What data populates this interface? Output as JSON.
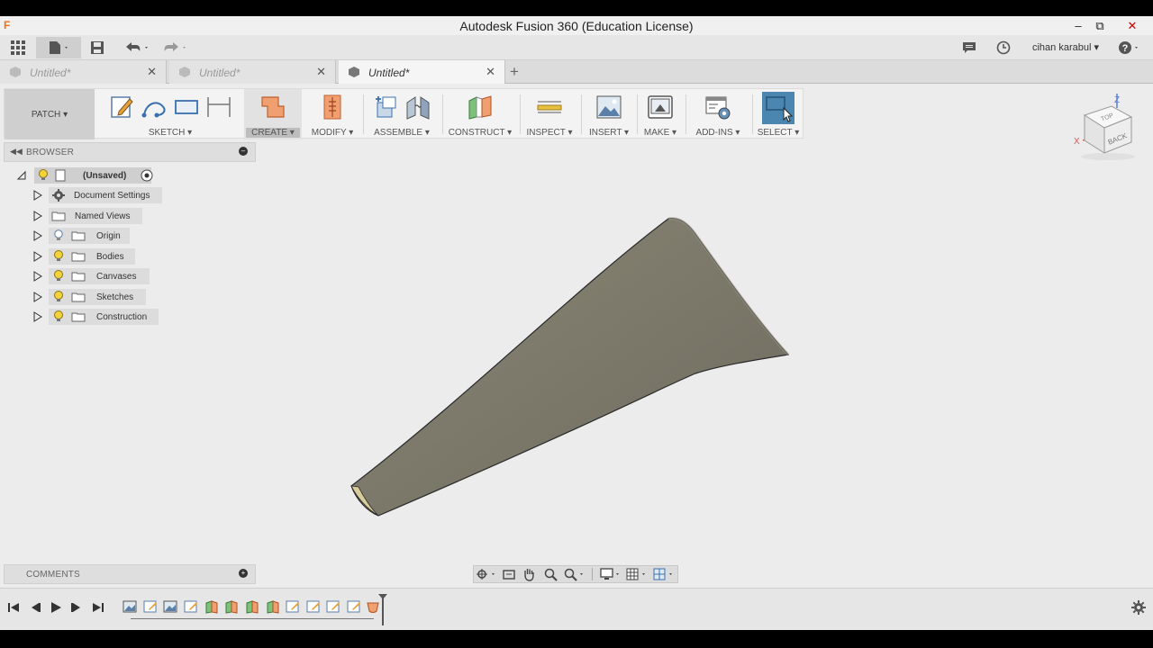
{
  "window": {
    "title": "Autodesk Fusion 360 (Education License)"
  },
  "qat": {
    "user": "cihan karabul"
  },
  "tabs": [
    {
      "label": "Untitled*",
      "active": false
    },
    {
      "label": "Untitled*",
      "active": false
    },
    {
      "label": "Untitled*",
      "active": true
    }
  ],
  "toolbar": {
    "workspace": "PATCH",
    "groups": {
      "sketch": "SKETCH",
      "create": "CREATE",
      "modify": "MODIFY",
      "assemble": "ASSEMBLE",
      "construct": "CONSTRUCT",
      "inspect": "INSPECT",
      "insert": "INSERT",
      "make": "MAKE",
      "addins": "ADD-INS",
      "select": "SELECT"
    }
  },
  "browser": {
    "title": "BROWSER",
    "root": "(Unsaved)",
    "items": [
      {
        "label": "Document Settings"
      },
      {
        "label": "Named Views"
      },
      {
        "label": "Origin"
      },
      {
        "label": "Bodies"
      },
      {
        "label": "Canvases"
      },
      {
        "label": "Sketches"
      },
      {
        "label": "Construction"
      }
    ]
  },
  "comments": {
    "title": "COMMENTS"
  },
  "viewcube": {
    "back": "BACK",
    "top": "TOP",
    "axis_x": "X",
    "axis_z": "Z"
  },
  "colors": {
    "accent": "#e8741b",
    "select_blue": "#4a86b0",
    "body": "#7d7a6e"
  }
}
